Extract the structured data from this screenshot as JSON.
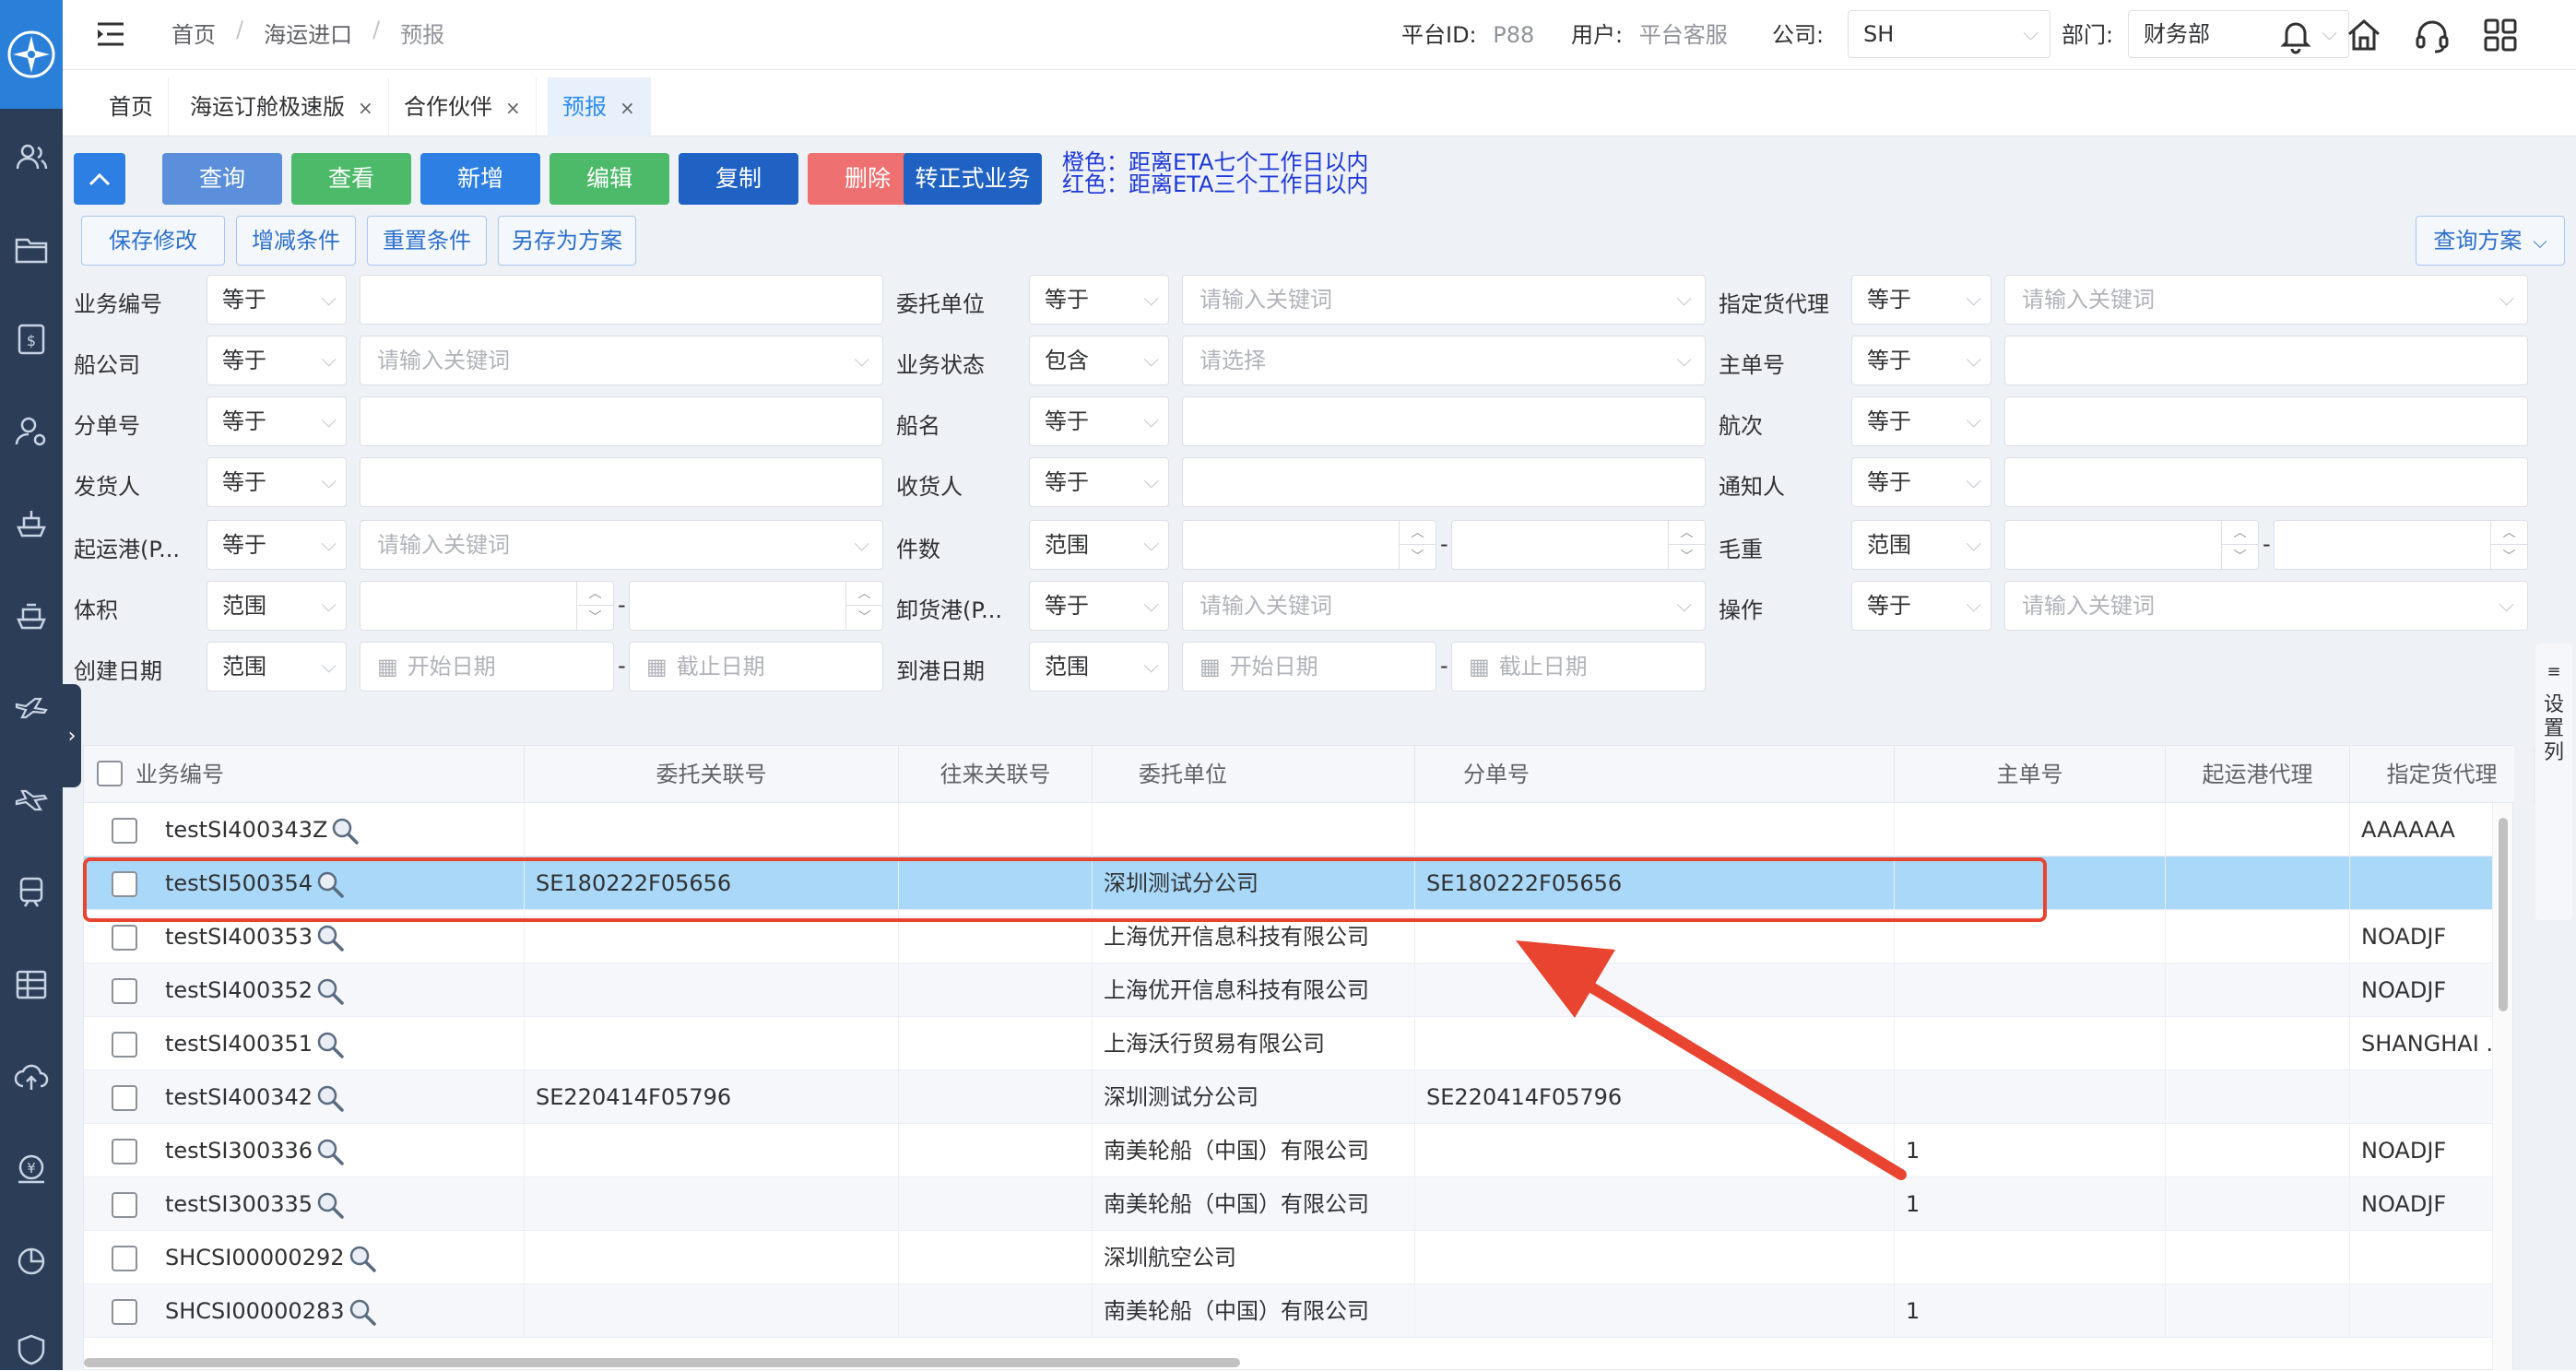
{
  "breadcrumb": [
    "首页",
    "海运进口",
    "预报"
  ],
  "topbar": {
    "platform_label": "平台ID:",
    "platform_value": "P88",
    "user_label": "用户:",
    "user_value": "平台客服",
    "company_label": "公司:",
    "company_value": "SH",
    "dept_label": "部门:",
    "dept_value": "财务部"
  },
  "tabs": [
    {
      "label": "首页",
      "closable": false
    },
    {
      "label": "海运订舱极速版",
      "closable": true
    },
    {
      "label": "合作伙伴",
      "closable": true
    },
    {
      "label": "预报",
      "closable": true,
      "active": true
    }
  ],
  "toolbar": {
    "buttons": [
      {
        "label": "查询",
        "color": "#5b8fdb"
      },
      {
        "label": "查看",
        "color": "#4dba6a"
      },
      {
        "label": "新增",
        "color": "#2d7fe3"
      },
      {
        "label": "编辑",
        "color": "#4dba6a"
      },
      {
        "label": "复制",
        "color": "#1f62c4"
      },
      {
        "label": "删除",
        "color": "#ef7070"
      },
      {
        "label": "转正式业务",
        "color": "#1f62c4"
      }
    ],
    "legend_orange": "橙色：距离ETA七个工作日以内",
    "legend_red": "红色：距离ETA三个工作日以内"
  },
  "filter_actions": [
    "保存修改",
    "增减条件",
    "重置条件",
    "另存为方案"
  ],
  "query_plan_label": "查询方案",
  "filters": {
    "r1": [
      {
        "label": "业务编号",
        "op": "等于",
        "value": ""
      },
      {
        "label": "委托单位",
        "op": "等于",
        "placeholder": "请输入关键词"
      },
      {
        "label": "指定货代理",
        "op": "等于",
        "placeholder": "请输入关键词"
      }
    ],
    "r2": [
      {
        "label": "船公司",
        "op": "等于",
        "placeholder": "请输入关键词"
      },
      {
        "label": "业务状态",
        "op": "包含",
        "placeholder": "请选择"
      },
      {
        "label": "主单号",
        "op": "等于",
        "value": ""
      }
    ],
    "r3": [
      {
        "label": "分单号",
        "op": "等于",
        "value": ""
      },
      {
        "label": "船名",
        "op": "等于",
        "value": ""
      },
      {
        "label": "航次",
        "op": "等于",
        "value": ""
      }
    ],
    "r4": [
      {
        "label": "发货人",
        "op": "等于",
        "value": ""
      },
      {
        "label": "收货人",
        "op": "等于",
        "value": ""
      },
      {
        "label": "通知人",
        "op": "等于",
        "value": ""
      }
    ],
    "r5": [
      {
        "label": "起运港(P...",
        "op": "等于",
        "placeholder": "请输入关键词"
      },
      {
        "label": "件数",
        "op": "范围"
      },
      {
        "label": "毛重",
        "op": "范围"
      }
    ],
    "r6": [
      {
        "label": "体积",
        "op": "范围"
      },
      {
        "label": "卸货港(P...",
        "op": "等于",
        "placeholder": "请输入关键词"
      },
      {
        "label": "操作",
        "op": "等于",
        "placeholder": "请输入关键词"
      }
    ],
    "r7": [
      {
        "label": "创建日期",
        "op": "范围",
        "start": "开始日期",
        "end": "截止日期"
      },
      {
        "label": "到港日期",
        "op": "范围",
        "start": "开始日期",
        "end": "截止日期"
      }
    ]
  },
  "table": {
    "columns": [
      "业务编号",
      "委托关联号",
      "往来关联号",
      "委托单位",
      "分单号",
      "主单号",
      "起运港代理",
      "指定货代理"
    ],
    "rows": [
      {
        "id": "testSI400343Z",
        "ref": "",
        "rel": "",
        "client": "",
        "hbl": "",
        "mbl": "",
        "agent": "",
        "fwd": "AAAAAA"
      },
      {
        "id": "testSI500354",
        "ref": "SE180222F05656",
        "rel": "",
        "client": "深圳测试分公司",
        "hbl": "SE180222F05656",
        "mbl": "",
        "agent": "",
        "fwd": "",
        "selected": true
      },
      {
        "id": "testSI400353",
        "ref": "",
        "rel": "",
        "client": "上海优开信息科技有限公司",
        "hbl": "",
        "mbl": "",
        "agent": "",
        "fwd": "NOADJF"
      },
      {
        "id": "testSI400352",
        "ref": "",
        "rel": "",
        "client": "上海优开信息科技有限公司",
        "hbl": "",
        "mbl": "",
        "agent": "",
        "fwd": "NOADJF"
      },
      {
        "id": "testSI400351",
        "ref": "",
        "rel": "",
        "client": "上海沃行贸易有限公司",
        "hbl": "",
        "mbl": "",
        "agent": "",
        "fwd": "SHANGHAI ..."
      },
      {
        "id": "testSI400342",
        "ref": "SE220414F05796",
        "rel": "",
        "client": "深圳测试分公司",
        "hbl": "SE220414F05796",
        "mbl": "",
        "agent": "",
        "fwd": ""
      },
      {
        "id": "testSI300336",
        "ref": "",
        "rel": "",
        "client": "南美轮船（中国）有限公司",
        "hbl": "",
        "mbl": "1",
        "agent": "",
        "fwd": "NOADJF"
      },
      {
        "id": "testSI300335",
        "ref": "",
        "rel": "",
        "client": "南美轮船（中国）有限公司",
        "hbl": "",
        "mbl": "1",
        "agent": "",
        "fwd": "NOADJF"
      },
      {
        "id": "SHCSI00000292",
        "ref": "",
        "rel": "",
        "client": "深圳航空公司",
        "hbl": "",
        "mbl": "",
        "agent": "",
        "fwd": ""
      },
      {
        "id": "SHCSI00000283",
        "ref": "",
        "rel": "",
        "client": "南美轮船（中国）有限公司",
        "hbl": "",
        "mbl": "1",
        "agent": "",
        "fwd": ""
      }
    ]
  },
  "settings_column_label": "设置列",
  "annotation_color": "#e84430"
}
